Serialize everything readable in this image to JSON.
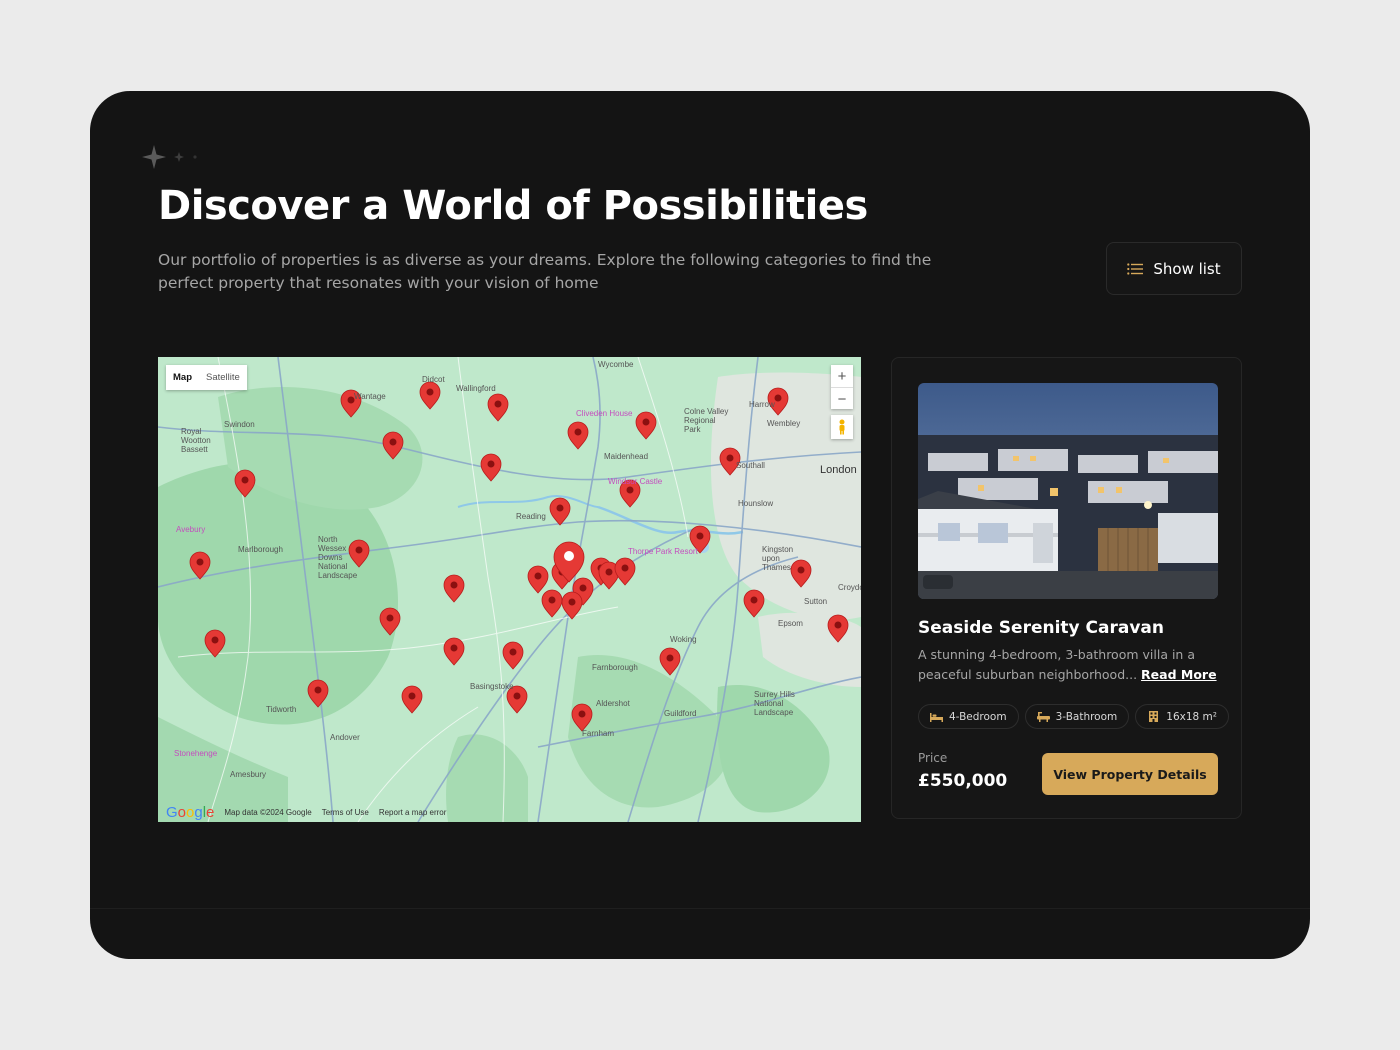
{
  "header": {
    "title": "Discover a World of Possibilities",
    "subtitle": "Our portfolio of properties is as diverse as your dreams. Explore the following categories to find the perfect property that resonates with your vision of home",
    "show_list_label": "Show list"
  },
  "map": {
    "type_options": [
      "Map",
      "Satellite"
    ],
    "selected_type": "Map",
    "zoom_in": "+",
    "zoom_out": "−",
    "footer": {
      "logo": "Google",
      "data": "Map data ©2024 Google",
      "terms": "Terms of Use",
      "report": "Report a map error"
    },
    "places": [
      {
        "name": "Wycombe",
        "kind": "town"
      },
      {
        "name": "Didcot",
        "kind": "town"
      },
      {
        "name": "Wallingford",
        "kind": "town"
      },
      {
        "name": "Wantage",
        "kind": "town"
      },
      {
        "name": "Swindon",
        "kind": "town"
      },
      {
        "name": "Royal Wootton Bassett",
        "kind": "town"
      },
      {
        "name": "Avebury",
        "kind": "poi"
      },
      {
        "name": "Marlborough",
        "kind": "town"
      },
      {
        "name": "North Wessex Downs National Landscape",
        "kind": "area"
      },
      {
        "name": "Reading",
        "kind": "town"
      },
      {
        "name": "Maidenhead",
        "kind": "town"
      },
      {
        "name": "Cliveden House",
        "kind": "poi"
      },
      {
        "name": "Colne Valley Regional Park",
        "kind": "area"
      },
      {
        "name": "Harrow",
        "kind": "town"
      },
      {
        "name": "Wembley",
        "kind": "town"
      },
      {
        "name": "Southall",
        "kind": "town"
      },
      {
        "name": "London",
        "kind": "city"
      },
      {
        "name": "Windsor Castle",
        "kind": "poi"
      },
      {
        "name": "Hounslow",
        "kind": "town"
      },
      {
        "name": "Thorpe Park Resort",
        "kind": "poi"
      },
      {
        "name": "Kingston upon Thames",
        "kind": "town"
      },
      {
        "name": "Croydon",
        "kind": "town"
      },
      {
        "name": "Sutton",
        "kind": "town"
      },
      {
        "name": "Epsom",
        "kind": "town"
      },
      {
        "name": "Woking",
        "kind": "town"
      },
      {
        "name": "Farnborough",
        "kind": "town"
      },
      {
        "name": "Basingstoke",
        "kind": "town"
      },
      {
        "name": "Aldershot",
        "kind": "town"
      },
      {
        "name": "Guildford",
        "kind": "town"
      },
      {
        "name": "Surrey Hills National Landscape",
        "kind": "area"
      },
      {
        "name": "Farnham",
        "kind": "town"
      },
      {
        "name": "Tidworth",
        "kind": "town"
      },
      {
        "name": "Andover",
        "kind": "town"
      },
      {
        "name": "Stonehenge",
        "kind": "poi"
      },
      {
        "name": "Amesbury",
        "kind": "town"
      }
    ]
  },
  "property": {
    "name": "Seaside Serenity Caravan",
    "description": "A stunning 4-bedroom, 3-bathroom villa in a peaceful suburban neighborhood...",
    "read_more": "Read More",
    "tags": [
      {
        "label": "4-Bedroom",
        "icon": "bed-icon"
      },
      {
        "label": "3-Bathroom",
        "icon": "bathtub-icon"
      },
      {
        "label": "16x18 m²",
        "icon": "building-icon"
      }
    ],
    "price_label": "Price",
    "price": "£550,000",
    "cta_label": "View Property Details"
  },
  "colors": {
    "background": "#ebebeb",
    "card": "#141414",
    "accent": "#d7a95a",
    "map_land": "#b9e6c6",
    "marker": "#e53935"
  }
}
